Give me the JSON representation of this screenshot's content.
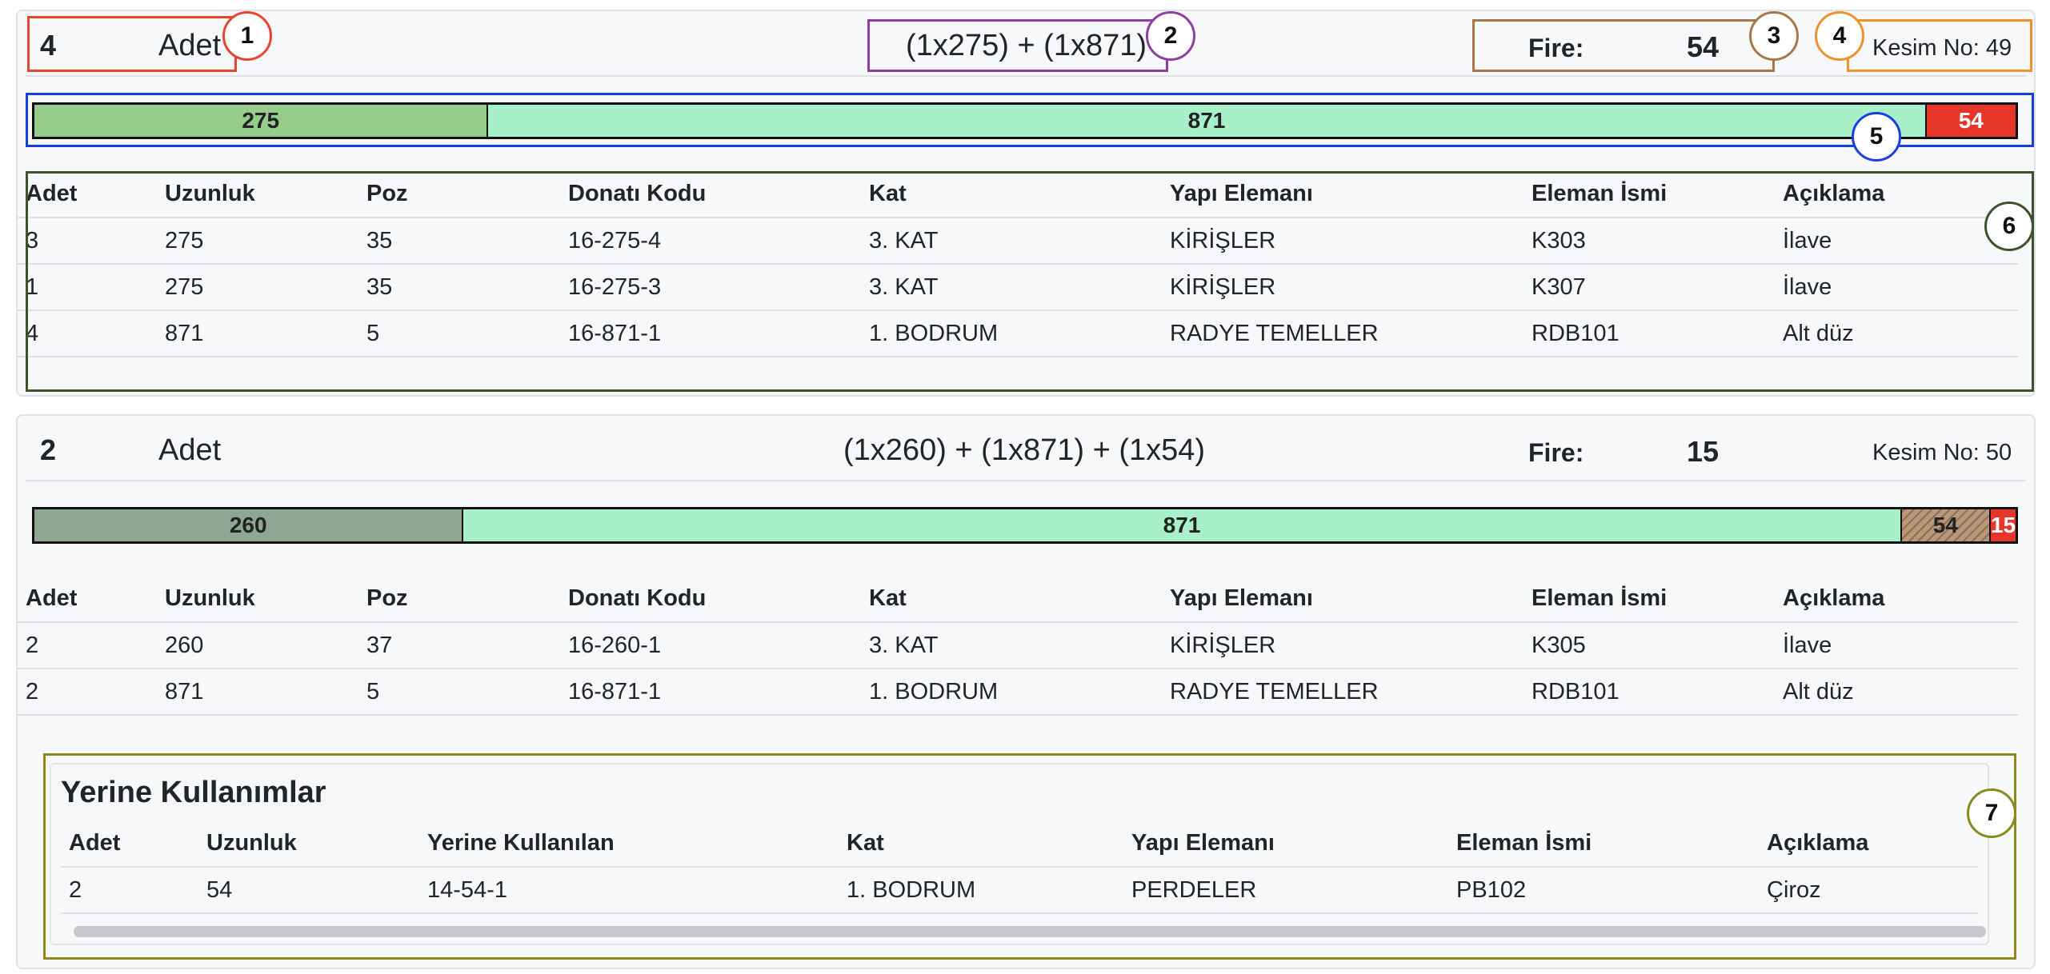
{
  "cuts": [
    {
      "count": "4",
      "unit_label": "Adet",
      "formula": [
        "(1x",
        "275",
        ") + (1x",
        "871",
        ")"
      ],
      "fire_label": "Fire:",
      "fire_value": "54",
      "kesim_no": "Kesim No: 49",
      "bar": [
        {
          "label": "275",
          "length": 275,
          "color": "#98cc8c",
          "kind": "piece"
        },
        {
          "label": "871",
          "length": 871,
          "color": "#a8f0c9",
          "kind": "piece"
        },
        {
          "label": "54",
          "length": 54,
          "color": "#e8352a",
          "kind": "fire"
        }
      ],
      "table_headers": [
        "Adet",
        "Uzunluk",
        "Poz",
        "Donatı Kodu",
        "Kat",
        "Yapı Elemanı",
        "Eleman İsmi",
        "Açıklama"
      ],
      "rows": [
        [
          "3",
          "275",
          "35",
          "16-275-4",
          "3. KAT",
          "KİRİŞLER",
          "K303",
          "İlave"
        ],
        [
          "1",
          "275",
          "35",
          "16-275-3",
          "3. KAT",
          "KİRİŞLER",
          "K307",
          "İlave"
        ],
        [
          "4",
          "871",
          "5",
          "16-871-1",
          "1. BODRUM",
          "RADYE TEMELLER",
          "RDB101",
          "Alt düz"
        ]
      ]
    },
    {
      "count": "2",
      "unit_label": "Adet",
      "formula": [
        "(1x",
        "260",
        ") + (1x",
        "871",
        ") + (1x",
        "54",
        ")"
      ],
      "fire_label": "Fire:",
      "fire_value": "15",
      "kesim_no": "Kesim No: 50",
      "bar": [
        {
          "label": "260",
          "length": 260,
          "color": "#8fa694",
          "kind": "piece"
        },
        {
          "label": "871",
          "length": 871,
          "color": "#a8f0c9",
          "kind": "piece"
        },
        {
          "label": "54",
          "length": 54,
          "color": "#a5876b",
          "kind": "reuse"
        },
        {
          "label": "15",
          "length": 15,
          "color": "#e8352a",
          "kind": "fire"
        }
      ],
      "table_headers": [
        "Adet",
        "Uzunluk",
        "Poz",
        "Donatı Kodu",
        "Kat",
        "Yapı Elemanı",
        "Eleman İsmi",
        "Açıklama"
      ],
      "rows": [
        [
          "2",
          "260",
          "37",
          "16-260-1",
          "3. KAT",
          "KİRİŞLER",
          "K305",
          "İlave"
        ],
        [
          "2",
          "871",
          "5",
          "16-871-1",
          "1. BODRUM",
          "RADYE TEMELLER",
          "RDB101",
          "Alt düz"
        ]
      ],
      "reuse": {
        "title": "Yerine Kullanımlar",
        "headers": [
          "Adet",
          "Uzunluk",
          "Yerine Kullanılan",
          "Kat",
          "Yapı Elemanı",
          "Eleman İsmi",
          "Açıklama"
        ],
        "rows": [
          [
            "2",
            "54",
            "14-54-1",
            "1. BODRUM",
            "PERDELER",
            "PB102",
            "Çiroz"
          ]
        ]
      }
    }
  ],
  "annotations": [
    {
      "label": "1",
      "color": "#e8452e"
    },
    {
      "label": "2",
      "color": "#8e3fa0"
    },
    {
      "label": "3",
      "color": "#a8784a"
    },
    {
      "label": "4",
      "color": "#f0922e"
    },
    {
      "label": "5",
      "color": "#1a3fe0"
    },
    {
      "label": "6",
      "color": "#3d5228"
    },
    {
      "label": "7",
      "color": "#8c8a1e"
    }
  ]
}
